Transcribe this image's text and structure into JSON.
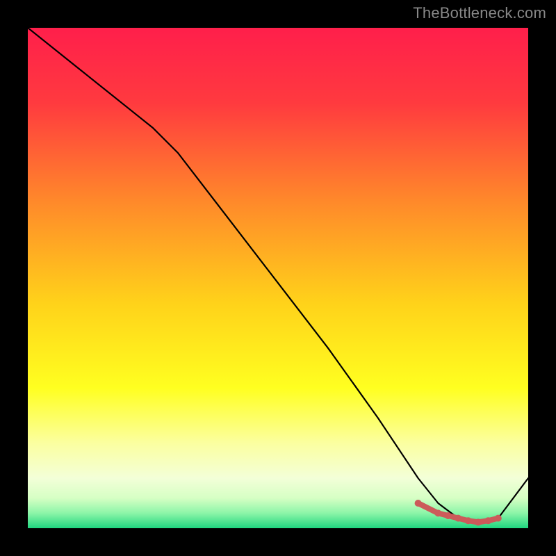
{
  "watermark": "TheBottleneck.com",
  "chart_data": {
    "type": "line",
    "title": "",
    "xlabel": "",
    "ylabel": "",
    "xlim": [
      0,
      100
    ],
    "ylim": [
      0,
      100
    ],
    "series": [
      {
        "name": "curve",
        "color": "#000000",
        "x": [
          0,
          10,
          20,
          25,
          30,
          40,
          50,
          60,
          70,
          78,
          82,
          86,
          90,
          94,
          100
        ],
        "y": [
          100,
          92,
          84,
          80,
          75,
          62,
          49,
          36,
          22,
          10,
          5,
          2,
          1,
          2,
          10
        ]
      }
    ],
    "marker_band": {
      "name": "optimum",
      "color": "#cc5a5a",
      "x": [
        78,
        82,
        84,
        86,
        88,
        90,
        92,
        94
      ],
      "y": [
        5,
        3,
        2.5,
        2,
        1.5,
        1.2,
        1.5,
        2
      ]
    },
    "background_gradient": {
      "stops": [
        {
          "pos": 0.0,
          "color": "#ff1f4b"
        },
        {
          "pos": 0.15,
          "color": "#ff3a3f"
        },
        {
          "pos": 0.35,
          "color": "#ff8a2a"
        },
        {
          "pos": 0.55,
          "color": "#ffd21a"
        },
        {
          "pos": 0.72,
          "color": "#ffff20"
        },
        {
          "pos": 0.83,
          "color": "#fbffa0"
        },
        {
          "pos": 0.9,
          "color": "#f3ffd8"
        },
        {
          "pos": 0.94,
          "color": "#d6ffc4"
        },
        {
          "pos": 0.97,
          "color": "#8cf5a8"
        },
        {
          "pos": 1.0,
          "color": "#1fd67f"
        }
      ]
    }
  }
}
